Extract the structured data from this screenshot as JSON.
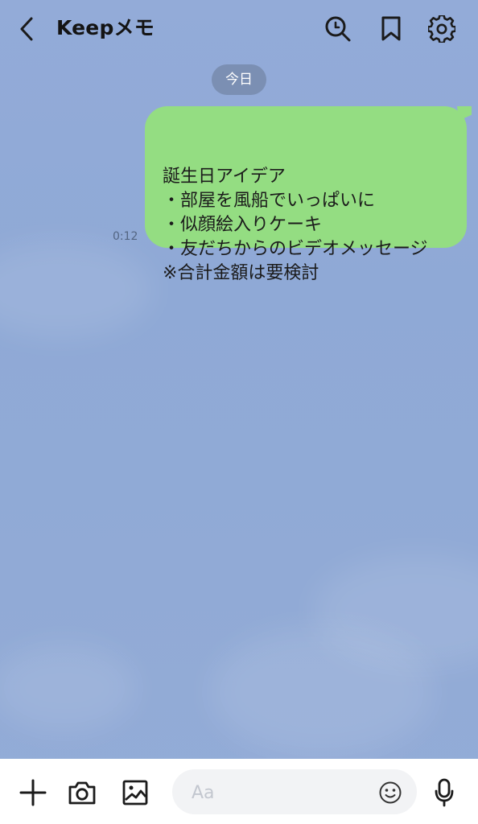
{
  "app": {
    "title": "Keepメモ"
  },
  "header": {
    "icons": {
      "back": "chevron-left-icon",
      "search": "search-icon",
      "bookmark": "bookmark-icon",
      "settings": "gear-icon"
    }
  },
  "chat": {
    "date_label": "今日",
    "message": {
      "time": "0:12",
      "text": "誕生日アイデア\n・部屋を風船でいっぱいに\n・似顔絵入りケーキ\n・友だちからのビデオメッセージ\n※合計金額は要検討"
    }
  },
  "composer": {
    "placeholder": "Aa",
    "value": "",
    "icons": {
      "add": "plus-icon",
      "camera": "camera-icon",
      "gallery": "image-icon",
      "emoji": "smile-icon",
      "mic": "microphone-icon"
    }
  },
  "colors": {
    "background": "#93abd8",
    "bubble": "#94dd82",
    "date_pill": "#76879f",
    "footer": "#ffffff",
    "input": "#f2f3f5"
  }
}
